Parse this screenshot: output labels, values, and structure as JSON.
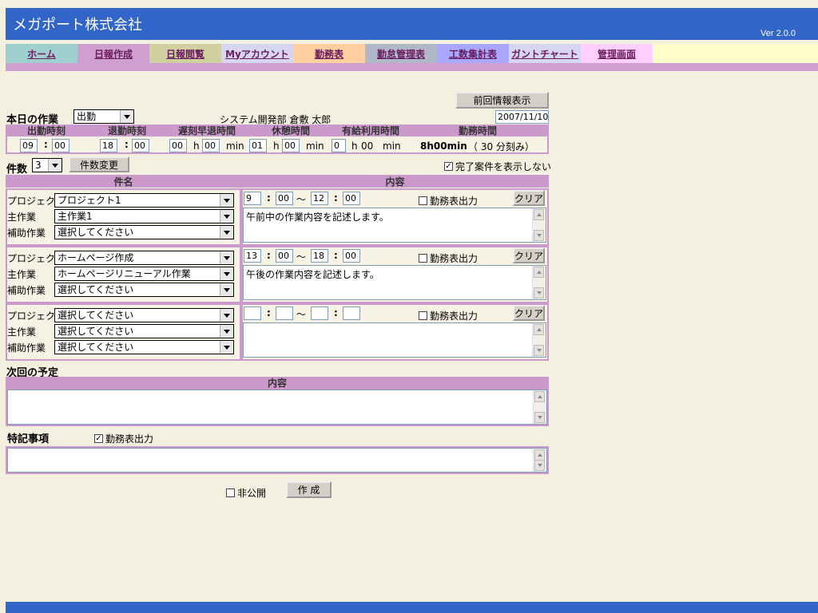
{
  "header": {
    "company": "メガポート株式会社",
    "version": "Ver 2.0.0"
  },
  "nav": [
    {
      "label": "ホーム",
      "color": "#9fcfcf"
    },
    {
      "label": "日報作成",
      "color": "#cf9fcf"
    },
    {
      "label": "日報閲覧",
      "color": "#cfcf9f"
    },
    {
      "label": "Myアカウント",
      "color": "#d6d6f0"
    },
    {
      "label": "勤務表",
      "color": "#ffcf9f"
    },
    {
      "label": "勤怠管理表",
      "color": "#b0b8c8"
    },
    {
      "label": "工数集計表",
      "color": "#a8a8ff"
    },
    {
      "label": "ガントチャート",
      "color": "#d6d6f0"
    },
    {
      "label": "管理画面",
      "color": "#ffcfff"
    }
  ],
  "form": {
    "prev_info_button": "前回情報表示",
    "today_work_label": "本日の作業",
    "attendance_value": "出勤",
    "department_user": "システム開発部  倉敷 太郎",
    "date": "2007/11/10",
    "time_headers": [
      "出勤時刻",
      "退勤時刻",
      "遅刻早退時間",
      "休憩時間",
      "有給利用時間",
      "勤務時間"
    ],
    "start_h": "09",
    "start_m": "00",
    "end_h": "18",
    "end_m": "00",
    "late_h": "00",
    "late_m": "00",
    "break_h": "01",
    "break_m": "00",
    "paid_h": "0",
    "paid_m": "00",
    "h_unit": "h",
    "min_unit": "min",
    "work_time": "8h00min",
    "rounding": "（ 30   分刻み）",
    "count_label": "件数",
    "count_value": "3",
    "count_change_button": "件数変更",
    "hide_done_label": "完了案件を表示しない",
    "col_name": "件名",
    "col_content": "内容",
    "project_label": "プロジェクト",
    "main_label": "主作業",
    "sub_label": "補助作業",
    "colon": ":",
    "tilde": "〜",
    "timesheet_label": "勤務表出力",
    "clear_button": "クリア",
    "tasks": [
      {
        "project": "プロジェクト1",
        "main": "主作業1",
        "sub": "選択してください",
        "sh": "9",
        "sm": "00",
        "eh": "12",
        "em": "00",
        "content": "午前中の作業内容を記述します。"
      },
      {
        "project": "ホームページ作成",
        "main": "ホームページリニューアル作業",
        "sub": "選択してください",
        "sh": "13",
        "sm": "00",
        "eh": "18",
        "em": "00",
        "content": "午後の作業内容を記述します。"
      },
      {
        "project": "選択してください",
        "main": "選択してください",
        "sub": "選択してください",
        "sh": "",
        "sm": "",
        "eh": "",
        "em": "",
        "content": ""
      }
    ],
    "next_plan_label": "次回の予定",
    "next_content_header": "内容",
    "special_label": "特記事項",
    "special_timesheet_label": "勤務表出力",
    "private_label": "非公開",
    "create_button": "作 成"
  }
}
